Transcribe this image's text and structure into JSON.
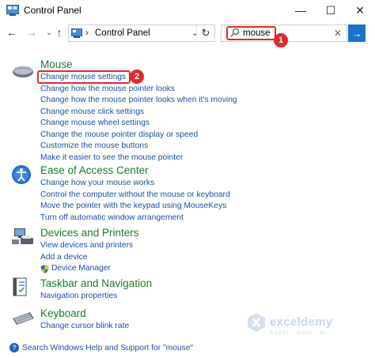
{
  "window": {
    "title": "Control Panel",
    "minimize_glyph": "—",
    "maximize_glyph": "☐",
    "close_glyph": "✕"
  },
  "nav": {
    "back_glyph": "←",
    "forward_glyph": "→",
    "up_glyph": "↑",
    "separator": "›",
    "breadcrumb": "Control Panel",
    "dropdown_glyph": "⌄",
    "refresh_glyph": "↻"
  },
  "search": {
    "value": "mouse",
    "clear_glyph": "✕",
    "go_glyph": "→"
  },
  "annotations": [
    "1",
    "2"
  ],
  "groups": [
    {
      "title": "Mouse",
      "icon": "mouse-icon",
      "links": [
        "Change mouse settings",
        "Change how the mouse pointer looks",
        "Change how the mouse pointer looks when it's moving",
        "Change mouse click settings",
        "Change mouse wheel settings",
        "Change the mouse pointer display or speed",
        "Customize the mouse buttons",
        "Make it easier to see the mouse pointer"
      ]
    },
    {
      "title": "Ease of Access Center",
      "icon": "ease-of-access-icon",
      "links": [
        "Change how your mouse works",
        "Control the computer without the mouse or keyboard",
        "Move the pointer with the keypad using MouseKeys",
        "Turn off automatic window arrangement"
      ]
    },
    {
      "title": "Devices and Printers",
      "icon": "devices-printers-icon",
      "links": [
        "View devices and printers",
        "Add a device",
        "Device Manager"
      ]
    },
    {
      "title": "Taskbar and Navigation",
      "icon": "taskbar-icon",
      "links": [
        "Navigation properties"
      ]
    },
    {
      "title": "Keyboard",
      "icon": "keyboard-icon",
      "links": [
        "Change cursor blink rate"
      ]
    }
  ],
  "watermark": {
    "title": "exceldemy",
    "subtitle": "EXCEL · DATA · BI"
  },
  "footer": {
    "text": "Search Windows Help and Support for \"mouse\""
  },
  "colors": {
    "group_title": "#1e7b2a",
    "link": "#1a4fa8",
    "highlight": "#e02a2a",
    "go_button": "#1a73c9"
  }
}
